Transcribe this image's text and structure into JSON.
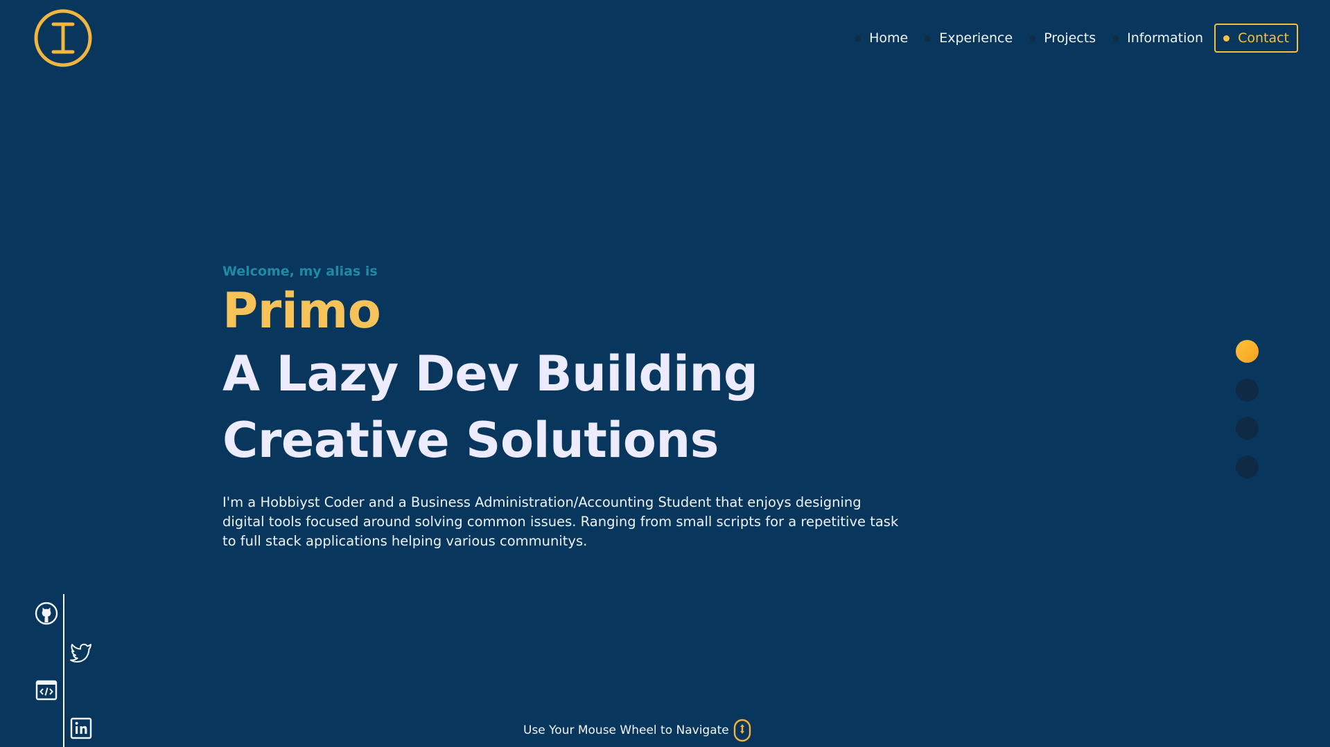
{
  "logo": {
    "icon": "cursor-i-logo-icon",
    "color": "#f2b53f"
  },
  "nav": {
    "items": [
      {
        "label": "Home"
      },
      {
        "label": "Experience"
      },
      {
        "label": "Projects"
      },
      {
        "label": "Information"
      }
    ],
    "contact_label": "Contact",
    "accent": "#f4c145"
  },
  "hero": {
    "welcome": "Welcome, my alias is",
    "name": "Primo",
    "headline_line1": "A Lazy Dev Building",
    "headline_line2": "Creative Solutions",
    "description": "I'm a Hobbiyst Coder and a Business Administration/Accounting Student that enjoys designing digital tools focused around solving common issues. Ranging from small scripts for a repetitive task to full stack applications helping various communitys."
  },
  "section_nav": {
    "count": 4,
    "active_index": 0,
    "active_color": "#fbb52e"
  },
  "social": {
    "icons": [
      "github-icon",
      "twitter-icon",
      "code-window-icon",
      "linkedin-icon"
    ]
  },
  "footer_hint": {
    "text": "Use Your Mouse Wheel to Navigate",
    "icon": "mouse-wheel-icon"
  },
  "colors": {
    "background": "#09365c",
    "accent": "#f6c35a",
    "welcome": "#1f8aa5"
  }
}
